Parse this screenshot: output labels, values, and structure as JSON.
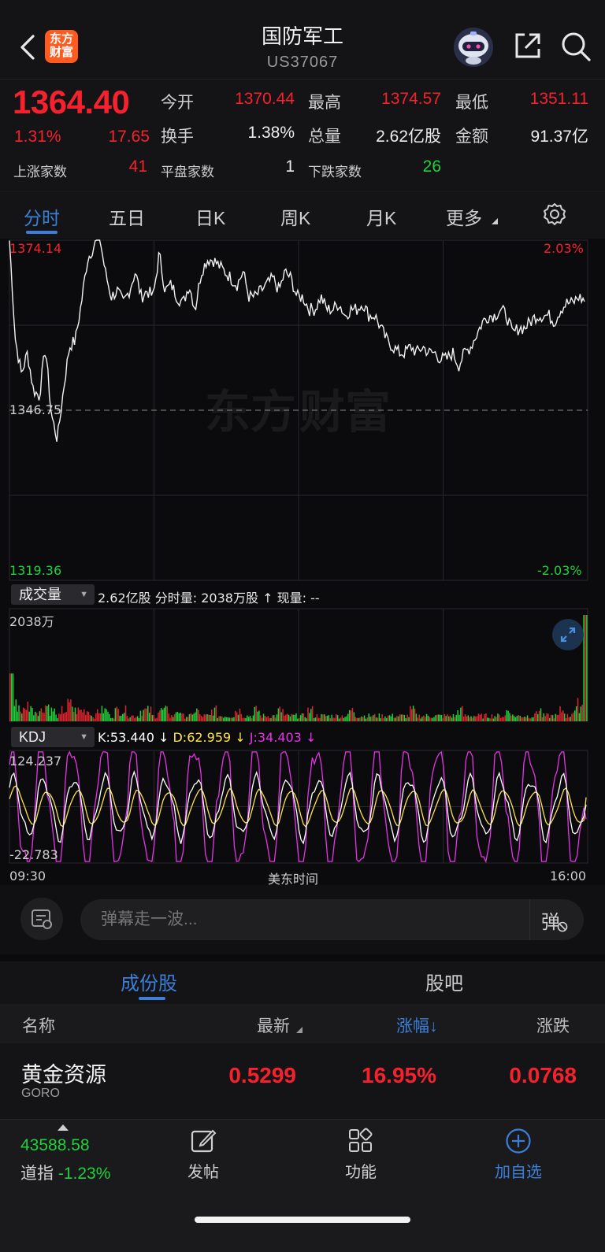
{
  "header": {
    "logo_text_1": "东方",
    "logo_text_2": "财富",
    "title": "国防军工",
    "code": "US37067"
  },
  "quote": {
    "price": "1364.40",
    "change_pct": "1.31%",
    "change_val": "17.65",
    "open_label": "今开",
    "open": "1370.44",
    "high_label": "最高",
    "high": "1374.57",
    "low_label": "最低",
    "low": "1351.11",
    "turnover_label": "换手",
    "turnover": "1.38%",
    "volume_label": "总量",
    "volume": "2.62亿股",
    "amount_label": "金额",
    "amount": "91.37亿",
    "up_label": "上涨家数",
    "up": "41",
    "flat_label": "平盘家数",
    "flat": "1",
    "down_label": "下跌家数",
    "down": "26"
  },
  "period_tabs": [
    "分时",
    "五日",
    "日K",
    "周K",
    "月K",
    "更多"
  ],
  "active_tab": 0,
  "chart_data": [
    {
      "type": "line",
      "title": "",
      "y_labels": {
        "top": "1374.14",
        "mid": "1346.75",
        "bottom": "1319.36",
        "top_pct": "2.03%",
        "bottom_pct": "-2.03%"
      },
      "ylim": [
        1319.36,
        1374.14
      ],
      "prev_close": 1346.75,
      "x_labels": [
        "09:30",
        "美东时间",
        "16:00"
      ],
      "series": [
        {
          "values": [
            1374.1,
            1358,
            1352.6,
            1356,
            1350,
            1349,
            1357,
            1346,
            1342,
            1350,
            1357,
            1358,
            1364,
            1371,
            1373,
            1375,
            1369,
            1365,
            1366,
            1364,
            1366,
            1369,
            1365,
            1366,
            1365,
            1372,
            1366,
            1367,
            1365,
            1364,
            1367,
            1363,
            1369,
            1371,
            1371,
            1370,
            1369,
            1368,
            1367,
            1369,
            1365,
            1365,
            1366,
            1367,
            1368,
            1366,
            1369,
            1368,
            1365,
            1365,
            1363,
            1363,
            1365,
            1363,
            1363,
            1364,
            1362,
            1363,
            1363,
            1364,
            1362,
            1362,
            1360,
            1358,
            1357,
            1356,
            1356,
            1357,
            1356,
            1357,
            1356,
            1356,
            1355,
            1355,
            1356,
            1354,
            1356,
            1357,
            1359,
            1361,
            1362,
            1362,
            1363,
            1362,
            1359,
            1360,
            1360,
            1361,
            1362,
            1362,
            1362,
            1361,
            1363,
            1364,
            1364,
            1365,
            1364.4
          ]
        }
      ]
    },
    {
      "type": "bar",
      "title": "",
      "selector": "成交量",
      "info": {
        "total": "2.62亿股",
        "minute_label": "分时量:",
        "minute_val": "2038万股",
        "arrow": "↑",
        "current_label": "现量:",
        "current_val": "--"
      },
      "y_max_label": "2038万",
      "values": [
        9,
        3,
        2,
        3,
        2,
        2,
        3,
        2,
        1,
        2,
        3,
        2,
        2,
        2,
        1,
        2,
        2,
        1,
        2,
        2,
        1,
        1,
        2,
        2,
        1,
        2,
        2,
        1,
        2,
        1,
        1,
        2,
        1,
        1,
        2,
        1,
        1,
        1,
        2,
        1,
        1,
        2,
        1,
        1,
        1,
        2,
        1,
        1,
        1,
        1,
        2,
        1,
        1,
        1,
        1,
        1,
        1,
        2,
        1,
        1,
        1,
        1,
        1,
        1,
        1,
        1,
        1,
        2,
        1,
        1,
        1,
        1,
        1,
        1,
        1,
        2,
        1,
        1,
        1,
        1,
        1,
        1,
        1,
        2,
        1,
        1,
        1,
        1,
        2,
        1,
        1,
        1,
        2,
        1,
        2,
        3,
        20
      ]
    },
    {
      "type": "line",
      "title": "",
      "selector": "KDJ",
      "legend": [
        {
          "name": "K",
          "value": "53.440",
          "color": "#ffffff"
        },
        {
          "name": "D",
          "value": "62.959",
          "color": "#ffe34d"
        },
        {
          "name": "J",
          "value": "34.403",
          "color": "#e633e6"
        }
      ],
      "y_labels": {
        "top": "124.237",
        "bottom": "-22.783"
      },
      "ylim": [
        -22.783,
        124.237
      ]
    }
  ],
  "danmaku": {
    "placeholder": "弹幕走一波...",
    "send_glyph": "弹"
  },
  "list": {
    "tabs": [
      "成份股",
      "股吧"
    ],
    "active_tab": 0,
    "columns": [
      "名称",
      "最新",
      "涨幅",
      "涨跌"
    ],
    "sort_arrow": "↓",
    "rows": [
      {
        "name": "黄金资源",
        "code": "GORO",
        "price": "0.5299",
        "pct": "16.95%",
        "chg": "0.0768"
      }
    ]
  },
  "bottom": {
    "index_value": "43588.58",
    "index_name": "道指",
    "index_pct": "-1.23%",
    "nav": [
      "发帖",
      "功能",
      "加自选"
    ]
  },
  "colors": {
    "up": "#f5222d",
    "down": "#1fd13a",
    "accent": "#3b7fd8"
  }
}
